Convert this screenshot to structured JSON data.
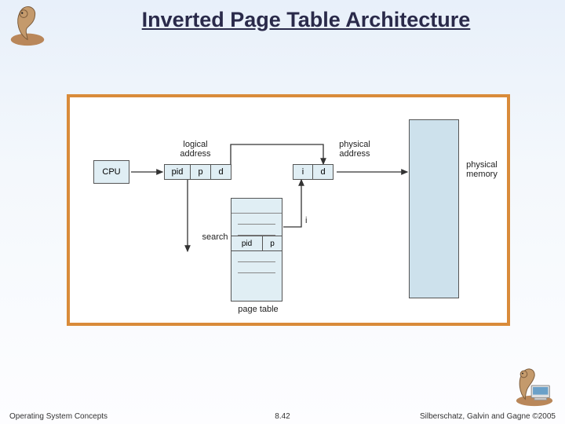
{
  "title": "Inverted Page Table Architecture",
  "footer": {
    "left": "Operating System Concepts",
    "center": "8.42",
    "right": "Silberschatz, Galvin and Gagne ©2005"
  },
  "diagram": {
    "cpu": "CPU",
    "logical_address": "logical\naddress",
    "physical_address": "physical\naddress",
    "physical_memory": "physical\nmemory",
    "page_table": "page table",
    "search": "search",
    "index_label": "i",
    "fields": {
      "pid": "pid",
      "p": "p",
      "d": "d",
      "i": "i"
    }
  }
}
